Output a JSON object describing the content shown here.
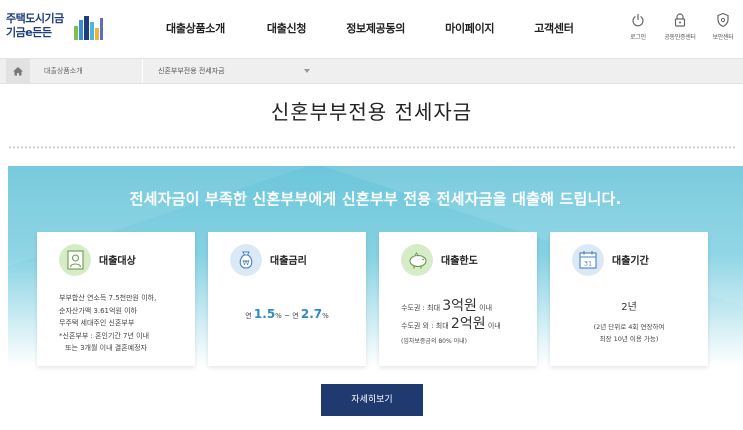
{
  "logo": {
    "line1": "주택도시기금",
    "line2": "기금e든든"
  },
  "nav": [
    "대출상품소개",
    "대출신청",
    "정보제공동의",
    "마이페이지",
    "고객센터"
  ],
  "util": [
    {
      "label": "로그인",
      "icon": "power-icon"
    },
    {
      "label": "공동인증센터",
      "icon": "lock-icon"
    },
    {
      "label": "보안센터",
      "icon": "shield-icon"
    }
  ],
  "breadcrumb": {
    "level1": "대출상품소개",
    "level2": "신혼부부전용 전세자금"
  },
  "page_title": "신혼부부전용 전세자금",
  "banner": {
    "headline": "전세자금이 부족한 신혼부부에게 신혼부부 전용 전세자금을 대출해 드립니다."
  },
  "cards": {
    "target": {
      "title": "대출대상",
      "icon": "person-card-icon",
      "lines": [
        "부부합산 연소득 7.5천만원 이하,",
        "순자산가액 3.61억원 이하",
        "무주택 세대주인 신혼부부",
        "*신혼부부 : 혼인기간 7년 이내",
        "또는 3개월 이내 결혼예정자"
      ]
    },
    "rate": {
      "title": "대출금리",
      "icon": "money-bag-icon",
      "prefix1": "연",
      "value1": "1.5",
      "unit1": "%",
      "sep": "~",
      "prefix2": "연",
      "value2": "2.7",
      "unit2": "%"
    },
    "limit": {
      "title": "대출한도",
      "icon": "piggy-bank-icon",
      "row1_prefix": "수도권 : 최대",
      "row1_big": "3억원",
      "row1_suffix": "이내",
      "row2_prefix": "수도권 외 : 최대",
      "row2_big": "2억원",
      "row2_suffix": "이내",
      "note": "(임차보증금의 80% 이내)"
    },
    "term": {
      "title": "대출기간",
      "icon": "calendar-icon",
      "calendar_day": "31",
      "main": "2년",
      "sub1": "(2년 단위로 4회 연장하여",
      "sub2": "최장 10년 이용 가능)"
    }
  },
  "detail_button": "자세히보기",
  "colors": {
    "navy": "#1e3a6e",
    "banner": "#6cc6da",
    "rate_blue": "#2e8cc7"
  }
}
